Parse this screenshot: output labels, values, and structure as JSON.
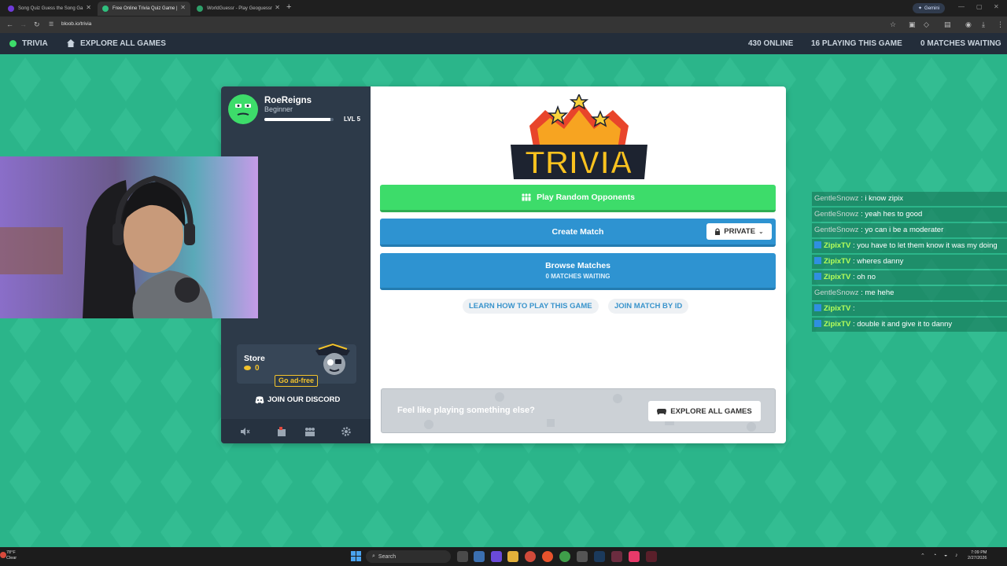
{
  "browser": {
    "tabs": [
      {
        "label": "Song Quiz Guess the Song Ga",
        "color": "#6f3bd8"
      },
      {
        "label": "Free Online Trivia Quiz Game |",
        "color": "#2fbf7e"
      },
      {
        "label": "WorldGuessr - Play Geoguessr",
        "color": "#2ea06a"
      }
    ],
    "gemini_label": "Gemini",
    "url": "bloob.io/trivia"
  },
  "sitenav": {
    "game_label": "TRIVIA",
    "explore_label": "EXPLORE ALL GAMES",
    "online": "430 ONLINE",
    "playing": "16 PLAYING THIS GAME",
    "waiting": "0 MATCHES WAITING"
  },
  "profile": {
    "username": "RoeReigns",
    "rank": "Beginner",
    "level": "LVL 5",
    "xp_progress": 0.95
  },
  "store": {
    "title": "Store",
    "coins": "0",
    "adfree": "Go ad-free"
  },
  "discord_label": "JOIN OUR DISCORD",
  "main": {
    "logo_text": "TRIVIA",
    "play_random": "Play Random Opponents",
    "create_match": "Create Match",
    "private_label": "PRIVATE",
    "browse_matches": "Browse Matches",
    "browse_sub": "0 MATCHES WAITING",
    "learn": "LEARN HOW TO PLAY THIS GAME",
    "join_by_id": "JOIN MATCH BY ID",
    "else_text": "Feel like playing something else?",
    "explore_btn": "EXPLORE ALL GAMES"
  },
  "chat": [
    {
      "user": "GentleSnowz",
      "msg": ": i know zipix",
      "style": "gray",
      "badge": false
    },
    {
      "user": "GentleSnowz",
      "msg": ": yeah hes to good",
      "style": "gray",
      "badge": false
    },
    {
      "user": "GentleSnowz",
      "msg": ": yo can i be a moderater",
      "style": "gray",
      "badge": false
    },
    {
      "user": "ZipixTV",
      "msg": ": you have to let them know it was my doing",
      "style": "green",
      "badge": true
    },
    {
      "user": "ZipixTV",
      "msg": ": wheres danny",
      "style": "green",
      "badge": true
    },
    {
      "user": "ZipixTV",
      "msg": ": oh no",
      "style": "green",
      "badge": true
    },
    {
      "user": "GentleSnowz",
      "msg": ": me hehe",
      "style": "gray",
      "badge": false
    },
    {
      "user": "ZipixTV",
      "msg": ":",
      "style": "green",
      "badge": true
    },
    {
      "user": "ZipixTV",
      "msg": ": double it and give it to danny",
      "style": "green",
      "badge": true
    }
  ],
  "taskbar": {
    "weather_temp": "78°F",
    "weather_desc": "Clear",
    "search_label": "Search",
    "time": "7:09 PM",
    "date": "2/27/2026"
  },
  "colors": {
    "page_bg": "#2bb58a",
    "nav_bg": "#232d3a",
    "green_btn": "#3ddc6a",
    "blue_btn": "#2e93d1",
    "coin": "#f3c32c"
  }
}
